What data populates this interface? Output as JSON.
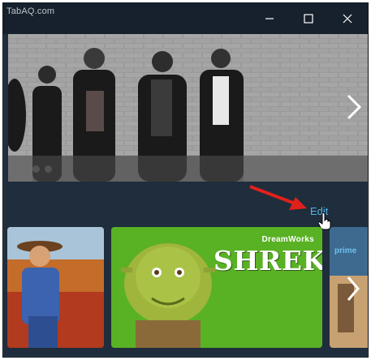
{
  "watermark": "TabAQ.com",
  "window_controls": {
    "minimize": "minimize-icon",
    "maximize": "maximize-icon",
    "close": "close-icon"
  },
  "hero": {
    "carousel_next_icon": "chevron-right-icon",
    "dots_count": 2
  },
  "edit_label": "Edit",
  "row": {
    "tiles": [
      {
        "name": "movie-tile-western"
      },
      {
        "name": "movie-tile-shrek",
        "brand": "DreamWorks",
        "title": "SHREK"
      },
      {
        "name": "movie-tile-prime",
        "badge": "prime"
      }
    ],
    "next_icon": "chevron-right-icon"
  },
  "colors": {
    "background": "#1f2d3c",
    "titlebar": "#17212d",
    "accent_link": "#5ab3e6",
    "annotation_arrow": "#e0211b"
  }
}
